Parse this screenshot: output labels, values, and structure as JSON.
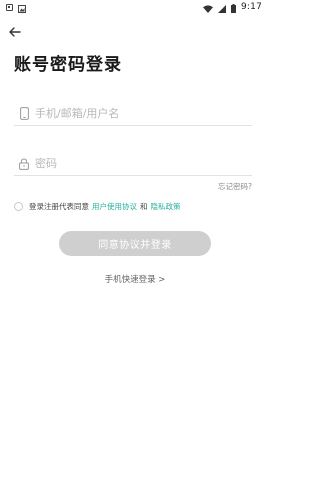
{
  "status_bar": {
    "time": "9:17",
    "left_icons": [
      "notification-square-icon",
      "image-notification-icon"
    ],
    "right_icons": [
      "wifi-icon",
      "cellular-signal-icon",
      "battery-icon"
    ]
  },
  "header": {
    "back_icon": "arrow-left-icon",
    "title": "账号密码登录"
  },
  "form": {
    "account": {
      "icon": "phone-icon",
      "placeholder": "手机/邮箱/用户名",
      "value": ""
    },
    "password": {
      "icon": "lock-icon",
      "placeholder": "密码",
      "value": ""
    },
    "forgot_label": "忘记密码?",
    "agreement": {
      "checked": false,
      "prefix": "登录注册代表同意",
      "user_agreement": "用户使用协议",
      "and": "和",
      "privacy_policy": "隐私政策",
      "link_color": "#27b29b"
    },
    "submit_label": "同意协议并登录",
    "submit_color": "#cfcfcf"
  },
  "alternate": {
    "quick_login_label": "手机快速登录 >"
  }
}
